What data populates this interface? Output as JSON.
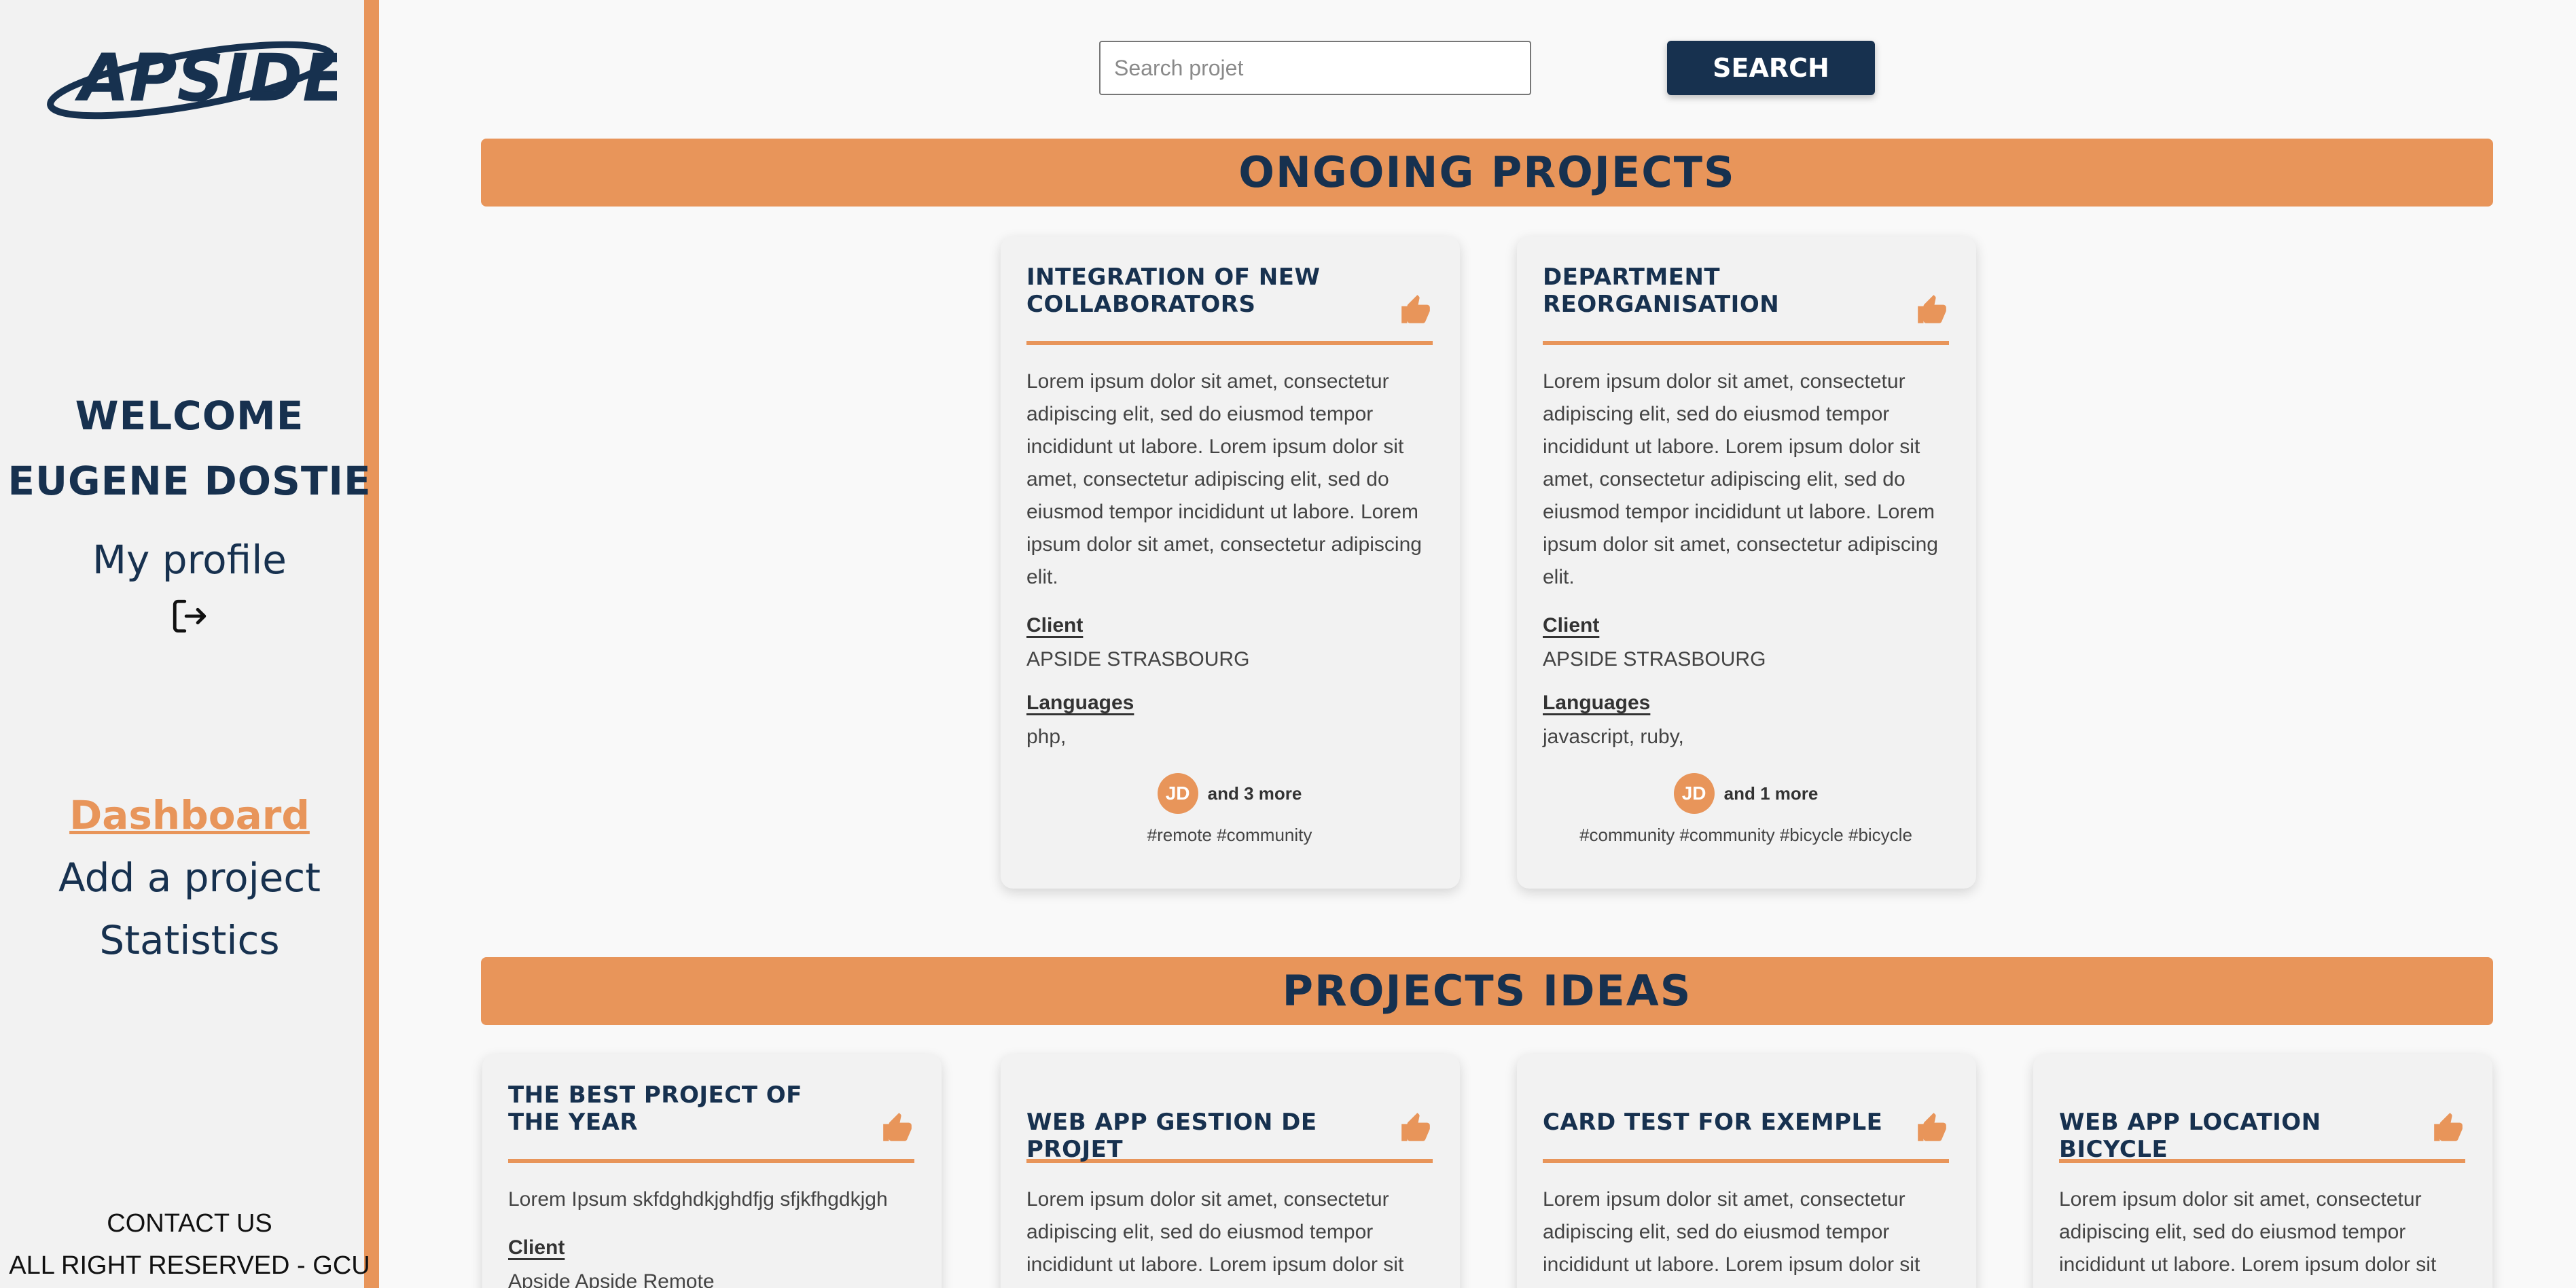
{
  "sidebar": {
    "logo_text": "APSIDE",
    "welcome_line1": "WELCOME",
    "welcome_line2": "EUGENE DOSTIE",
    "profile_label": "My profile",
    "logout_icon": "logout-icon",
    "nav": {
      "dashboard": "Dashboard",
      "add_project": "Add a project",
      "statistics": "Statistics"
    },
    "contact": "CONTACT US",
    "rights": "ALL RIGHT RESERVED - GCU"
  },
  "search": {
    "placeholder": "Search projet",
    "value": "",
    "button_label": "SEARCH"
  },
  "sections": {
    "ongoing_title": "ONGOING PROJECTS",
    "ideas_title": "PROJECTS IDEAS"
  },
  "labels": {
    "client": "Client",
    "languages": "Languages"
  },
  "ongoing": [
    {
      "title": "INTEGRATION OF NEW COLLABORATORS",
      "description": "Lorem ipsum dolor sit amet, consectetur adipiscing elit, sed do eiusmod tempor incididunt ut labore. Lorem ipsum dolor sit amet, consectetur adipiscing elit, sed do eiusmod tempor incididunt ut labore. Lorem ipsum dolor sit amet, consectetur adipiscing elit.",
      "client": "APSIDE STRASBOURG",
      "languages": "php,",
      "avatar": "JD",
      "more": "and 3 more",
      "tags": "#remote #community"
    },
    {
      "title": "DEPARTMENT REORGANISATION",
      "description": "Lorem ipsum dolor sit amet, consectetur adipiscing elit, sed do eiusmod tempor incididunt ut labore. Lorem ipsum dolor sit amet, consectetur adipiscing elit, sed do eiusmod tempor incididunt ut labore. Lorem ipsum dolor sit amet, consectetur adipiscing elit.",
      "client": "APSIDE STRASBOURG",
      "languages": "javascript, ruby,",
      "avatar": "JD",
      "more": "and 1 more",
      "tags": "#community #community #bicycle #bicycle"
    }
  ],
  "ideas": [
    {
      "title": "THE BEST PROJECT OF THE YEAR",
      "description": "Lorem Ipsum skfdghdkjghdfjg sfjkfhgdkjgh",
      "client": "Apside Apside Remote"
    },
    {
      "title": "WEB APP GESTION DE PROJET",
      "description": "Lorem ipsum dolor sit amet, consectetur adipiscing elit, sed do eiusmod tempor incididunt ut labore. Lorem ipsum dolor sit amet, consectetur adipiscing elit, sed do"
    },
    {
      "title": "CARD TEST FOR EXEMPLE",
      "description": "Lorem ipsum dolor sit amet, consectetur adipiscing elit, sed do eiusmod tempor incididunt ut labore. Lorem ipsum dolor sit amet, consectetur adipiscing elit, sed do"
    },
    {
      "title": "WEB APP LOCATION BICYCLE",
      "description": "Lorem ipsum dolor sit amet, consectetur adipiscing elit, sed do eiusmod tempor incididunt ut labore. Lorem ipsum dolor sit amet, consectetur adipiscing elit, sed do"
    }
  ],
  "colors": {
    "accent": "#e8955a",
    "navy": "#17314f",
    "sidebar_bg": "#f2f2f2"
  }
}
